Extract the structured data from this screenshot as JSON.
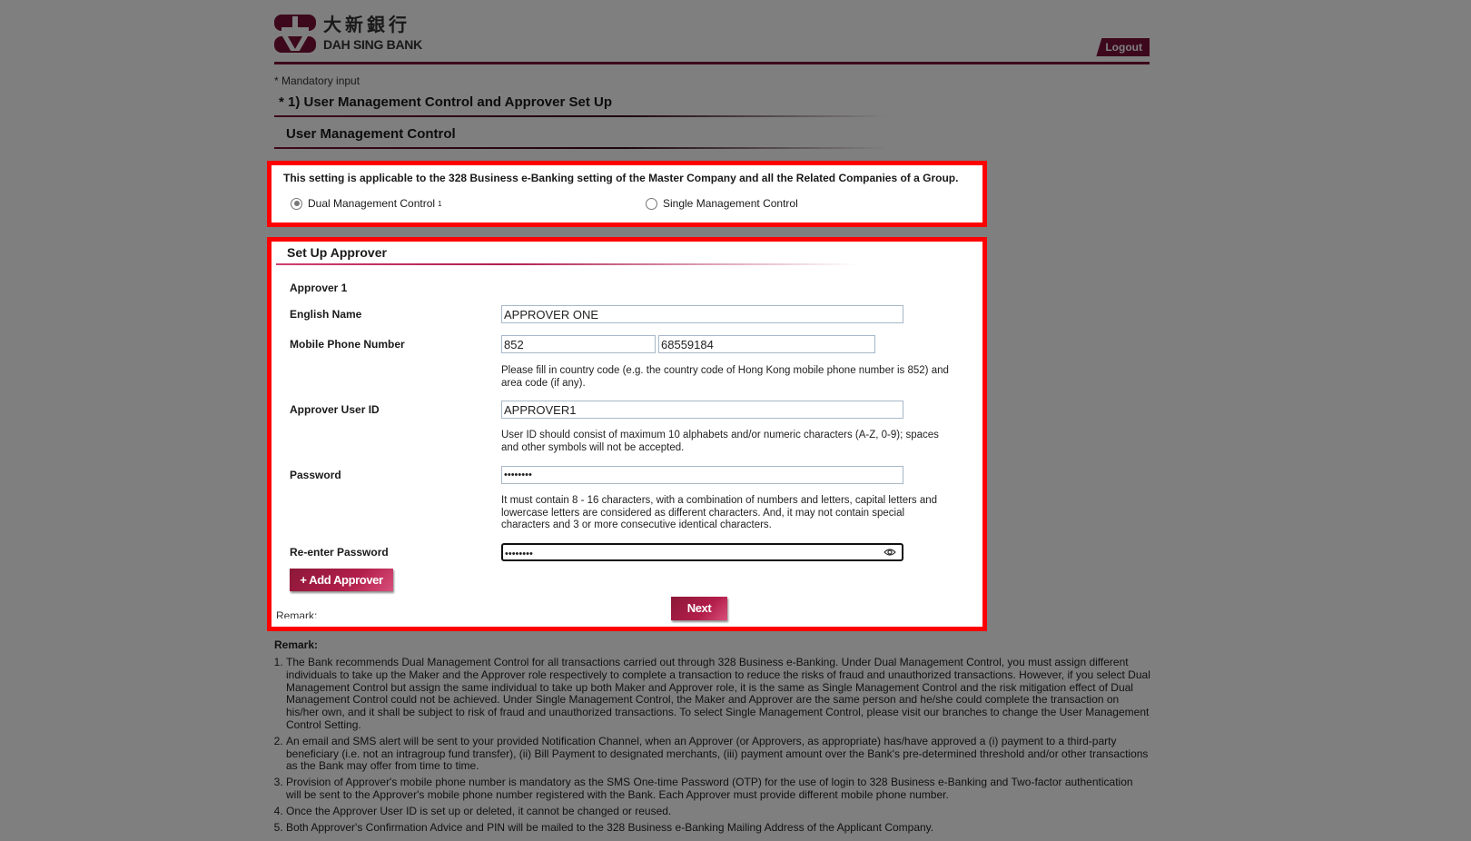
{
  "brand": {
    "name_cn": "大新銀行",
    "name_en": "DAH SING BANK",
    "color": "#7a1036"
  },
  "header": {
    "logout_label": "Logout"
  },
  "mandatory_note": "* Mandatory input",
  "section_title": "* 1) User Management Control and Approver Set Up",
  "umc": {
    "title": "User Management Control",
    "applicable_text": "This setting is applicable to the 328 Business e-Banking setting of the Master Company and all the Related Companies of a Group.",
    "options": [
      {
        "label": "Dual Management Control",
        "sup": "1",
        "selected": true
      },
      {
        "label": "Single Management Control",
        "selected": false
      }
    ]
  },
  "approver_setup": {
    "title": "Set Up Approver",
    "approver_heading": "Approver 1",
    "fields": {
      "english_name": {
        "label": "English Name",
        "value": "APPROVER ONE"
      },
      "mobile": {
        "label": "Mobile Phone Number",
        "country_code": "852",
        "number": "68559184",
        "help": "Please fill in country code (e.g. the country code of Hong Kong mobile phone number is 852) and area code (if any)."
      },
      "user_id": {
        "label": "Approver User ID",
        "value": "APPROVER1",
        "help": "User ID should consist of maximum 10 alphabets and/or numeric characters (A-Z, 0-9); spaces and other symbols will not be accepted."
      },
      "password": {
        "label": "Password",
        "value": "••••••••",
        "help": "It must contain 8 - 16 characters, with a combination of numbers and letters, capital letters and lowercase letters are considered as different characters. And, it may not contain special characters and 3 or more consecutive identical characters."
      },
      "reenter_password": {
        "label": "Re-enter Password",
        "value": "••••••••",
        "icon": "eye-icon"
      }
    },
    "add_approver_label": "+ Add Approver",
    "next_label": "Next",
    "remark_cut": "Remark:"
  },
  "remarks": {
    "title": "Remark:",
    "items": [
      "The Bank recommends Dual Management Control for all transactions carried out through 328 Business e-Banking. Under Dual Management Control, you must assign different individuals to take up the Maker and the Approver role respectively to complete a transaction to reduce the risks of fraud and unauthorized transactions. However, if you select Dual Management Control but assign the same individual to take up both Maker and Approver role, it is the same as Single Management Control and the risk mitigation effect of Dual Management Control could not be achieved. Under Single Management Control, the Maker and Approver are the same person and he/she could complete the transaction on his/her own, and it shall be subject to risk of fraud and unauthorized transactions. To select Single Management Control, please visit our branches to change the User Management Control Setting.",
      "An email and SMS alert will be sent to your provided Notification Channel, when an Approver (or Approvers, as appropriate) has/have approved a (i) payment to a third-party beneficiary (i.e. not an intragroup fund transfer), (ii) Bill Payment to designated merchants, (iii) payment amount over the Bank's pre-determined threshold and/or other transactions as the Bank may offer from time to time.",
      "Provision of Approver's mobile phone number is mandatory as the SMS One-time Password (OTP) for the use of login to 328 Business e-Banking and Two-factor authentication will be sent to the Approver's mobile phone number registered with the Bank. Each Approver must provide different mobile phone number.",
      "Once the Approver User ID is set up or deleted, it cannot be changed or reused.",
      "Both Approver's Confirmation Advice and PIN will be mailed to the 328 Business e-Banking Mailing Address of the Applicant Company."
    ]
  },
  "highlight_color": "#ff0000"
}
